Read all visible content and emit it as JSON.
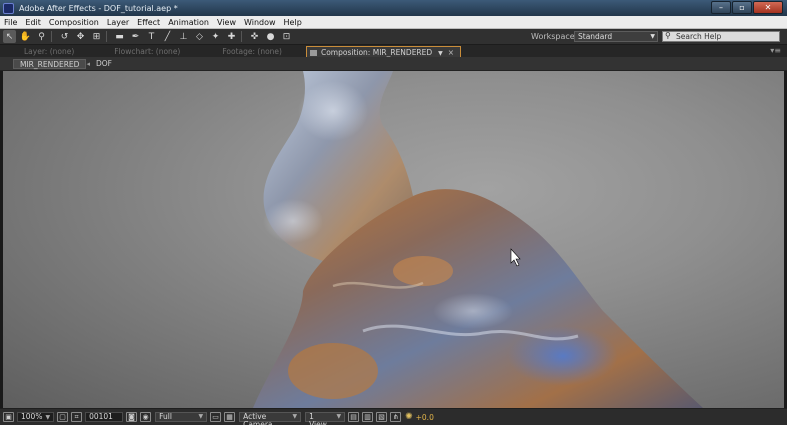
{
  "window": {
    "title": "Adobe After Effects - DOF_tutorial.aep *"
  },
  "menu": [
    "File",
    "Edit",
    "Composition",
    "Layer",
    "Effect",
    "Animation",
    "View",
    "Window",
    "Help"
  ],
  "toolbar": {
    "tools": [
      {
        "name": "selection-tool-icon",
        "glyph": "↖"
      },
      {
        "name": "hand-tool-icon",
        "glyph": "✋"
      },
      {
        "name": "zoom-tool-icon",
        "glyph": "⚲"
      },
      {
        "name": "rotate-tool-icon",
        "glyph": "↺"
      },
      {
        "name": "camera-orbit-tool-icon",
        "glyph": "✥"
      },
      {
        "name": "pan-behind-tool-icon",
        "glyph": "⊞"
      },
      {
        "name": "rectangle-mask-tool-icon",
        "glyph": "▬"
      },
      {
        "name": "pen-tool-icon",
        "glyph": "✒"
      },
      {
        "name": "type-tool-icon",
        "glyph": "T"
      },
      {
        "name": "brush-tool-icon",
        "glyph": "╱"
      },
      {
        "name": "clone-stamp-tool-icon",
        "glyph": "⊥"
      },
      {
        "name": "eraser-tool-icon",
        "glyph": "◇"
      },
      {
        "name": "roto-brush-tool-icon",
        "glyph": "✦"
      },
      {
        "name": "puppet-pin-tool-icon",
        "glyph": "✚"
      },
      {
        "name": "axis-mode-icon",
        "glyph": "✜"
      },
      {
        "name": "world-axis-icon",
        "glyph": "●"
      },
      {
        "name": "view-axis-icon",
        "glyph": "⊡"
      }
    ],
    "workspace_label": "Workspace:",
    "workspace_value": "Standard",
    "search_placeholder": "Search Help"
  },
  "tabs": {
    "layer": "Layer: (none)",
    "flowchart": "Flowchart: (none)",
    "footage": "Footage: (none)",
    "composition": "Composition: MIR_RENDERED",
    "close": "×",
    "menu": "▾≡"
  },
  "subtabs": {
    "active": "MIR_RENDERED",
    "separator": "◂",
    "other": "DOF"
  },
  "viewer_bar": {
    "magnification": "100%",
    "timecode": "00101",
    "resolution": "Full",
    "camera": "Active Camera",
    "views": "1 View",
    "exposure": "+0.0"
  }
}
